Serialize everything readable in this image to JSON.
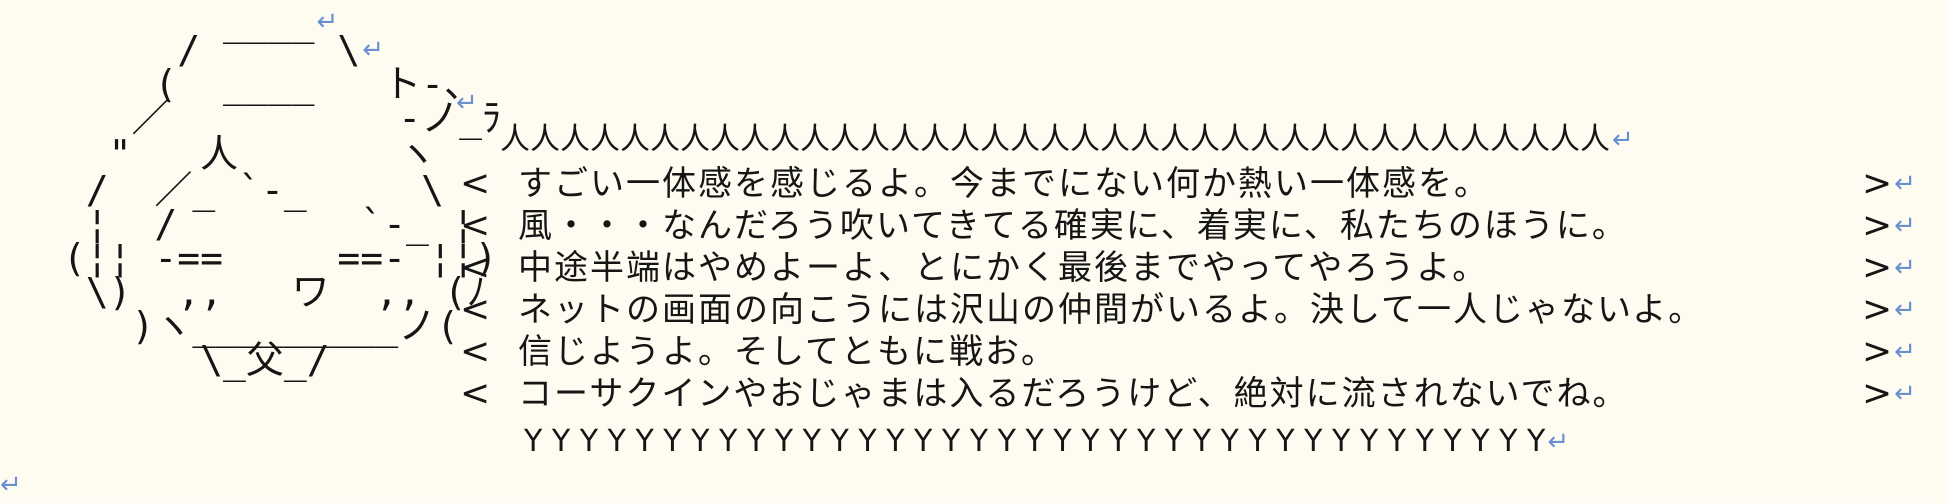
{
  "art_lines": [
    "        ____",
    "      /      \\",
    "     (  ____   ト-、",
    "    ／          -ノ_ﾗ",
    "   \"   人       ヽ",
    "  /  ／_ `-_     \\",
    "  ¦  /        `-_ ¦",
    " (¦¦ -==     ==- ¦¦)",
    "  \\)  ,,   ワ  ,, (ﾉ",
    "    )ヽ_________ノ(",
    "       \\_父_/"
  ],
  "bubble_top": "人人人人人人人人人人人人人人人人人人人人人人人人人人人人人人人人人人人人人",
  "left_bracket": "<",
  "right_bracket": ">",
  "messages": [
    "すごい一体感を感じるよ。今までにない何か熱い一体感を。",
    "風・・・なんだろう吹いてきてる確実に、着実に、私たちのほうに。",
    "中途半端はやめよーよ、とにかく最後までやってやろうよ。",
    "ネットの画面の向こうには沢山の仲間がいるよ。決して一人じゃないよ。",
    "信じようよ。そしてともに戦お。",
    "コーサクインやおじゃまは入るだろうけど、絶対に流されないでね。"
  ],
  "bubble_bottom": "Y Y Y Y Y Y Y Y Y Y Y Y Y Y Y Y Y Y Y Y Y Y Y Y Y Y Y Y Y Y Y Y Y Y Y Y Y",
  "return_mark": "↵"
}
